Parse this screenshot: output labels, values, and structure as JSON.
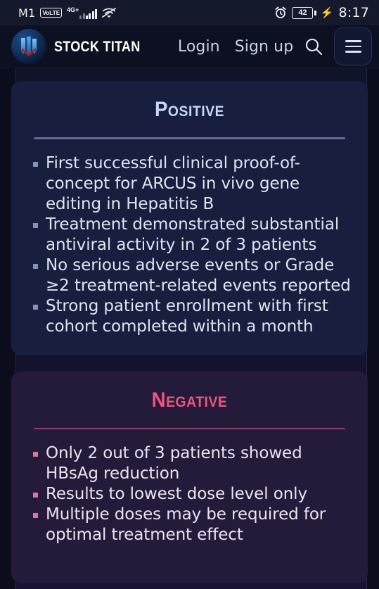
{
  "status_bar": {
    "carrier": "M1",
    "volte": "VoLTE",
    "network": "4G+",
    "battery_level": "42",
    "time": "8:17",
    "icons": {
      "alarm": "alarm-icon",
      "charging": "charging-bolt-icon",
      "signal": "signal-bars-icon",
      "wifi_off": "wifi-off-icon"
    }
  },
  "header": {
    "brand_name": "STOCK TITAN",
    "logo": "stock-titan-logo",
    "nav": [
      {
        "label": "Login"
      },
      {
        "label": "Sign up"
      }
    ],
    "search_icon": "search-icon",
    "menu_icon": "hamburger-menu-icon"
  },
  "cards": [
    {
      "title": "Positive",
      "accent": "#c3d8f7",
      "bullets": [
        "First successful clinical proof-of-concept for ARCUS in vivo gene editing in Hepatitis B",
        "Treatment demonstrated substantial antiviral activity in 2 of 3 patients",
        "No serious adverse events or Grade ≥2 treatment-related events reported",
        "Strong patient enrollment with first cohort completed within a month"
      ]
    },
    {
      "title": "Negative",
      "accent": "#f2537e",
      "bullets": [
        "Only 2 out of 3 patients showed HBsAg reduction",
        "Results to lowest dose level only",
        "Multiple doses may be required for optimal treatment effect"
      ]
    }
  ]
}
